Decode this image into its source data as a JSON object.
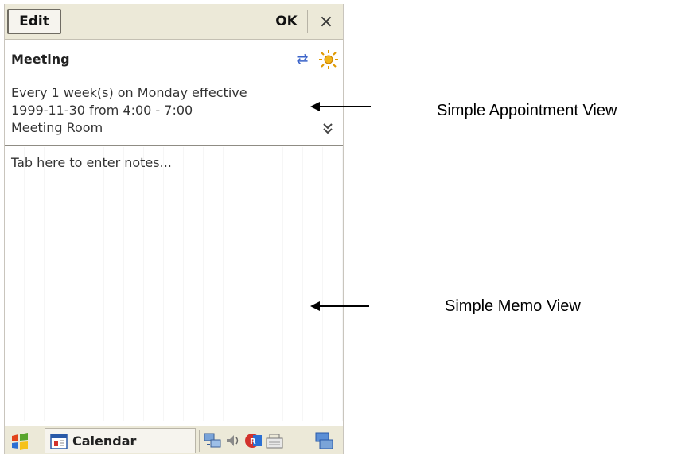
{
  "toolbar": {
    "edit_label": "Edit",
    "ok_label": "OK",
    "close_label": "×"
  },
  "appointment": {
    "title": "Meeting",
    "recurrence_line": "Every 1 week(s) on Monday effective",
    "date_time_line": "1999-11-30 from  4:00 -  7:00",
    "location": "Meeting Room",
    "expand_glyph": "»"
  },
  "notes": {
    "placeholder": "Tab here to enter notes..."
  },
  "taskbar": {
    "active_app": "Calendar"
  },
  "annotations": {
    "appointment_view": "Simple Appointment View",
    "memo_view": "Simple Memo View"
  },
  "colors": {
    "bar_background": "#ece9d8",
    "accent_blue": "#3a63c9"
  }
}
